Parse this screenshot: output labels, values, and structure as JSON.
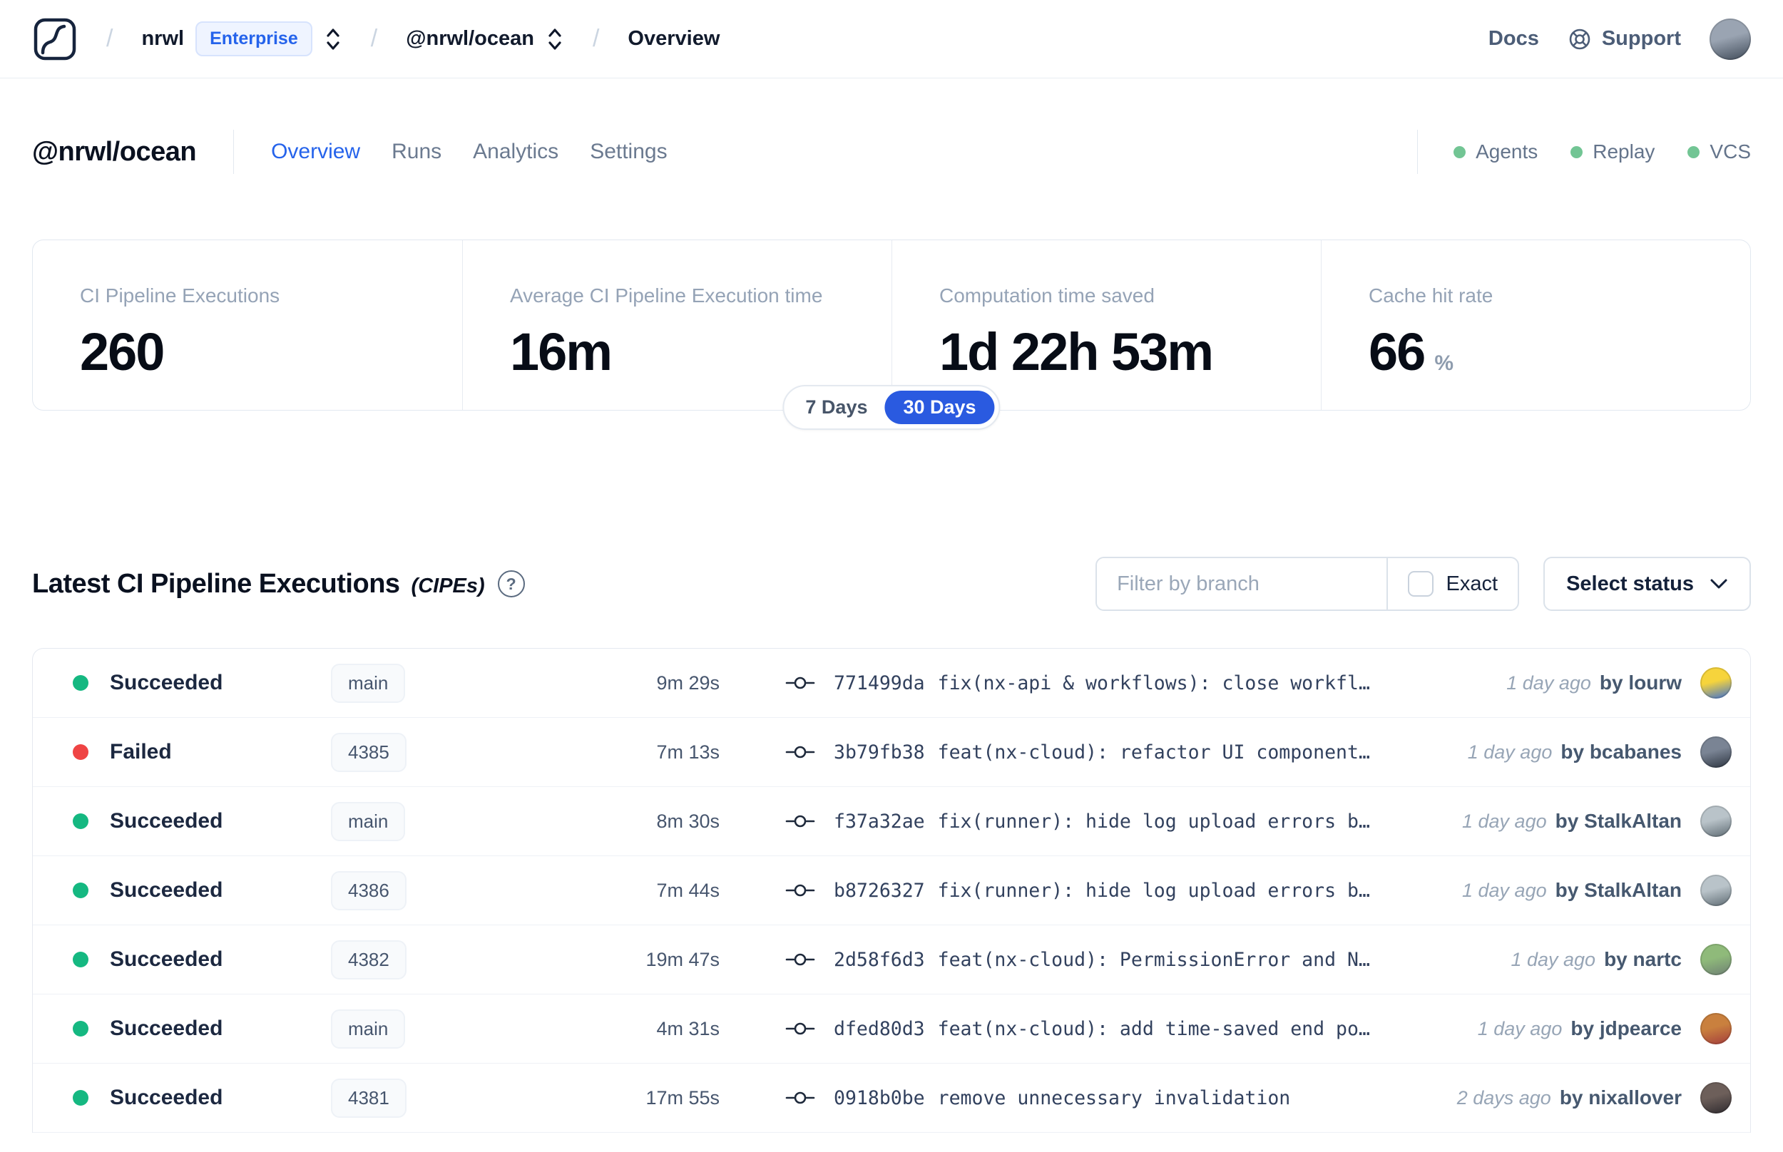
{
  "navbar": {
    "separator": "/",
    "org": "nrwl",
    "org_badge": "Enterprise",
    "workspace": "@nrwl/ocean",
    "page": "Overview",
    "docs_label": "Docs",
    "support_label": "Support",
    "user_avatar": {
      "top": "#9aa4b2",
      "bottom": "#3f4a58"
    }
  },
  "header": {
    "title": "@nrwl/ocean",
    "tabs": [
      {
        "label": "Overview"
      },
      {
        "label": "Runs"
      },
      {
        "label": "Analytics"
      },
      {
        "label": "Settings"
      }
    ],
    "active_tab": "Overview",
    "status_dot_color": "#72c594",
    "statuses": [
      {
        "label": "Agents"
      },
      {
        "label": "Replay"
      },
      {
        "label": "VCS"
      }
    ]
  },
  "stats": {
    "cards": [
      {
        "label": "CI Pipeline Executions",
        "value": "260",
        "unit": ""
      },
      {
        "label": "Average CI Pipeline Execution time",
        "value": "16m",
        "unit": ""
      },
      {
        "label": "Computation time saved",
        "value": "1d 22h 53m",
        "unit": ""
      },
      {
        "label": "Cache hit rate",
        "value": "66",
        "unit": "%"
      }
    ]
  },
  "period_toggle": {
    "options": [
      "7 Days",
      "30 Days"
    ],
    "active": "30 Days",
    "active_bg": "#2a5ae0"
  },
  "cipe_section": {
    "title": "Latest CI Pipeline Executions",
    "title_suffix": "(CIPEs)",
    "help_glyph": "?",
    "filter_placeholder": "Filter by branch",
    "exact_label": "Exact",
    "select_status_label": "Select status"
  },
  "table": {
    "rows": [
      {
        "status": "Succeeded",
        "status_color": "#15b881",
        "branch": "main",
        "duration": "9m 29s",
        "commit_hash": "771499da",
        "commit_message": "fix(nx-api & workflows): close workfl…",
        "time": "1 day ago",
        "author": "by lourw",
        "avatar": {
          "top": "#f6d43c",
          "bottom": "#3b6fd4"
        }
      },
      {
        "status": "Failed",
        "status_color": "#ef4444",
        "branch": "4385",
        "duration": "7m 13s",
        "commit_hash": "3b79fb38",
        "commit_message": "feat(nx-cloud): refactor UI component…",
        "time": "1 day ago",
        "author": "by bcabanes",
        "avatar": {
          "top": "#7a8494",
          "bottom": "#2c3440"
        }
      },
      {
        "status": "Succeeded",
        "status_color": "#15b881",
        "branch": "main",
        "duration": "8m 30s",
        "commit_hash": "f37a32ae",
        "commit_message": "fix(runner): hide log upload errors b…",
        "time": "1 day ago",
        "author": "by StalkAltan",
        "avatar": {
          "top": "#b9c3c9",
          "bottom": "#5d6a72"
        }
      },
      {
        "status": "Succeeded",
        "status_color": "#15b881",
        "branch": "4386",
        "duration": "7m 44s",
        "commit_hash": "b8726327",
        "commit_message": "fix(runner): hide log upload errors b…",
        "time": "1 day ago",
        "author": "by StalkAltan",
        "avatar": {
          "top": "#b9c3c9",
          "bottom": "#5d6a72"
        }
      },
      {
        "status": "Succeeded",
        "status_color": "#15b881",
        "branch": "4382",
        "duration": "19m 47s",
        "commit_hash": "2d58f6d3",
        "commit_message": "feat(nx-cloud): PermissionError and N…",
        "time": "1 day ago",
        "author": "by nartc",
        "avatar": {
          "top": "#8fba7a",
          "bottom": "#6e7f74"
        }
      },
      {
        "status": "Succeeded",
        "status_color": "#15b881",
        "branch": "main",
        "duration": "4m 31s",
        "commit_hash": "dfed80d3",
        "commit_message": "feat(nx-cloud): add time-saved end po…",
        "time": "1 day ago",
        "author": "by jdpearce",
        "avatar": {
          "top": "#c9803e",
          "bottom": "#a33c3c"
        }
      },
      {
        "status": "Succeeded",
        "status_color": "#15b881",
        "branch": "4381",
        "duration": "17m 55s",
        "commit_hash": "0918b0be",
        "commit_message": "remove unnecessary invalidation",
        "time": "2 days ago",
        "author": "by nixallover",
        "avatar": {
          "top": "#6d5f5a",
          "bottom": "#2e2a2e"
        }
      }
    ]
  }
}
